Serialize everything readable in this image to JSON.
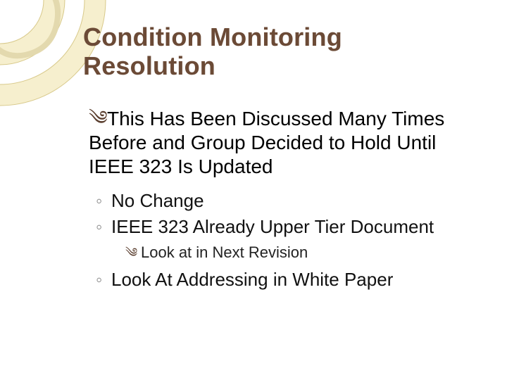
{
  "slide": {
    "title": "Condition Monitoring Resolution",
    "bullets": {
      "lvl1_1": "This Has Been Discussed Many Times Before and Group Decided to Hold Until IEEE 323 Is Updated",
      "lvl2_1": "No Change",
      "lvl2_2": "IEEE 323 Already Upper Tier Document",
      "lvl3_1": "Look at in Next Revision",
      "lvl2_3": "Look At Addressing in White Paper"
    }
  },
  "glyphs": {
    "swirl": "༄",
    "ring": "◦"
  },
  "colors": {
    "title": "#6b4a36",
    "deco_fill": "#f6efce",
    "deco_stroke": "#d8c98a"
  }
}
